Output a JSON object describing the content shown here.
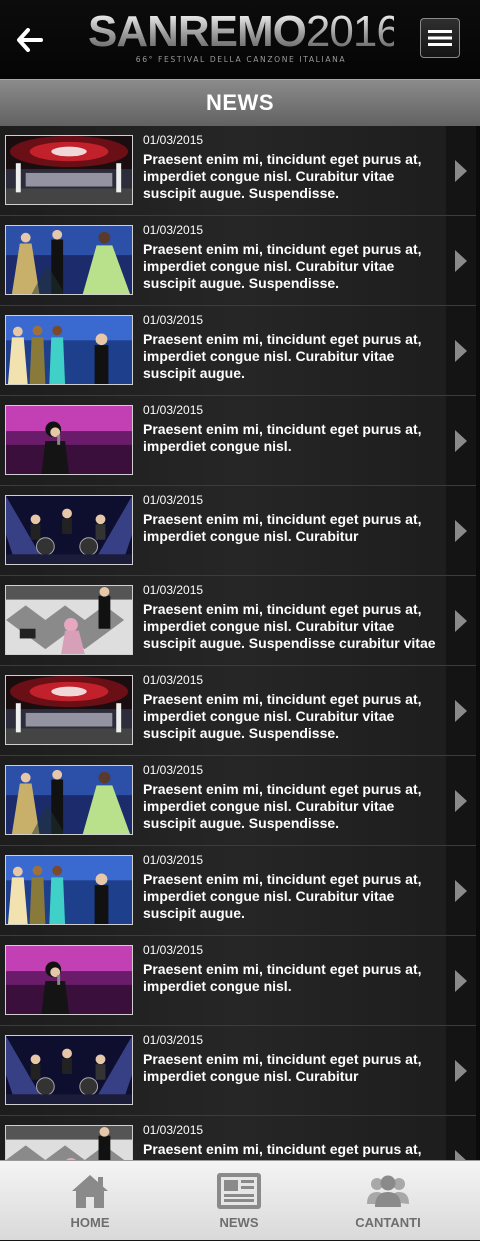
{
  "header": {
    "logo_title": "SANREMO",
    "logo_year": "2016",
    "logo_subtitle": "66° FESTIVAL DELLA CANZONE ITALIANA"
  },
  "section": {
    "title": "NEWS"
  },
  "news": [
    {
      "date": "01/03/2015",
      "text": "Praesent enim mi, tincidunt eget purus at, imperdiet congue nisl. Curabitur vitae suscipit augue. Suspendisse.",
      "thumb": "stage-wide"
    },
    {
      "date": "01/03/2015",
      "text": "Praesent enim mi, tincidunt eget purus at, imperdiet congue nisl. Curabitur vitae suscipit augue. Suspendisse.",
      "thumb": "presenters-gowns"
    },
    {
      "date": "01/03/2015",
      "text": "Praesent enim mi, tincidunt eget purus at, imperdiet congue nisl. Curabitur vitae suscipit augue.",
      "thumb": "hosts-group"
    },
    {
      "date": "01/03/2015",
      "text": "Praesent enim mi, tincidunt eget purus at, imperdiet congue nisl.",
      "thumb": "singer-pink"
    },
    {
      "date": "01/03/2015",
      "text": "Praesent enim mi, tincidunt eget purus at, imperdiet congue nisl. Curabitur",
      "thumb": "band-blue"
    },
    {
      "date": "01/03/2015",
      "text": "Praesent enim mi, tincidunt eget purus at, imperdiet congue nisl. Curabitur vitae suscipit augue. Suspendisse curabitur vitae suscipit",
      "thumb": "checkered-stage"
    },
    {
      "date": "01/03/2015",
      "text": "Praesent enim mi, tincidunt eget purus at, imperdiet congue nisl. Curabitur vitae suscipit augue. Suspendisse.",
      "thumb": "stage-wide"
    },
    {
      "date": "01/03/2015",
      "text": "Praesent enim mi, tincidunt eget purus at, imperdiet congue nisl. Curabitur vitae suscipit augue. Suspendisse.",
      "thumb": "presenters-gowns"
    },
    {
      "date": "01/03/2015",
      "text": "Praesent enim mi, tincidunt eget purus at, imperdiet congue nisl. Curabitur vitae suscipit augue.",
      "thumb": "hosts-group"
    },
    {
      "date": "01/03/2015",
      "text": "Praesent enim mi, tincidunt eget purus at, imperdiet congue nisl.",
      "thumb": "singer-pink"
    },
    {
      "date": "01/03/2015",
      "text": "Praesent enim mi, tincidunt eget purus at, imperdiet congue nisl. Curabitur",
      "thumb": "band-blue"
    },
    {
      "date": "01/03/2015",
      "text": "Praesent enim mi, tincidunt eget purus at,",
      "thumb": "checkered-stage"
    }
  ],
  "bottom_nav": [
    {
      "label": "HOME",
      "icon": "home-icon"
    },
    {
      "label": "NEWS",
      "icon": "newspaper-icon"
    },
    {
      "label": "CANTANTI",
      "icon": "users-icon"
    }
  ],
  "icons": {
    "back": "arrow-left-icon",
    "menu": "hamburger-menu-icon",
    "item_action": "chevron-right-icon"
  },
  "colors": {
    "header_bg": "#0a0a0a",
    "section_bar": "#777777",
    "list_bg": "#222222",
    "nav_bg": "#e8e8e8",
    "nav_text": "#6e6e6e"
  }
}
